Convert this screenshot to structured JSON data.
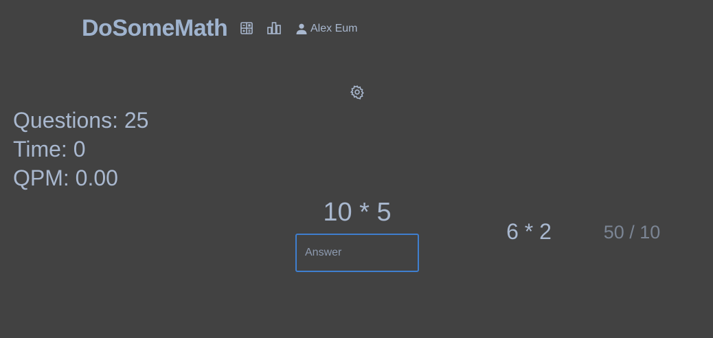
{
  "header": {
    "brand": "DoSomeMath",
    "icons": {
      "calculator": "calculator-icon",
      "leaderboard": "bar-chart-icon",
      "user": "person-icon"
    },
    "user_name": "Alex Eum"
  },
  "settings": {
    "icon": "gear-icon"
  },
  "stats": {
    "questions": "Questions: 25",
    "time": "Time: 0",
    "qpm": "QPM: 0.00"
  },
  "quiz": {
    "current_question": "10 * 5",
    "answer_placeholder": "Answer",
    "answer_value": "",
    "previous_question": "6 * 2",
    "previous_answer": "50 / 10"
  },
  "colors": {
    "background": "#424242",
    "text": "#a9b8cf",
    "accent_border": "#3f7fd0",
    "muted": "#7b8594"
  }
}
